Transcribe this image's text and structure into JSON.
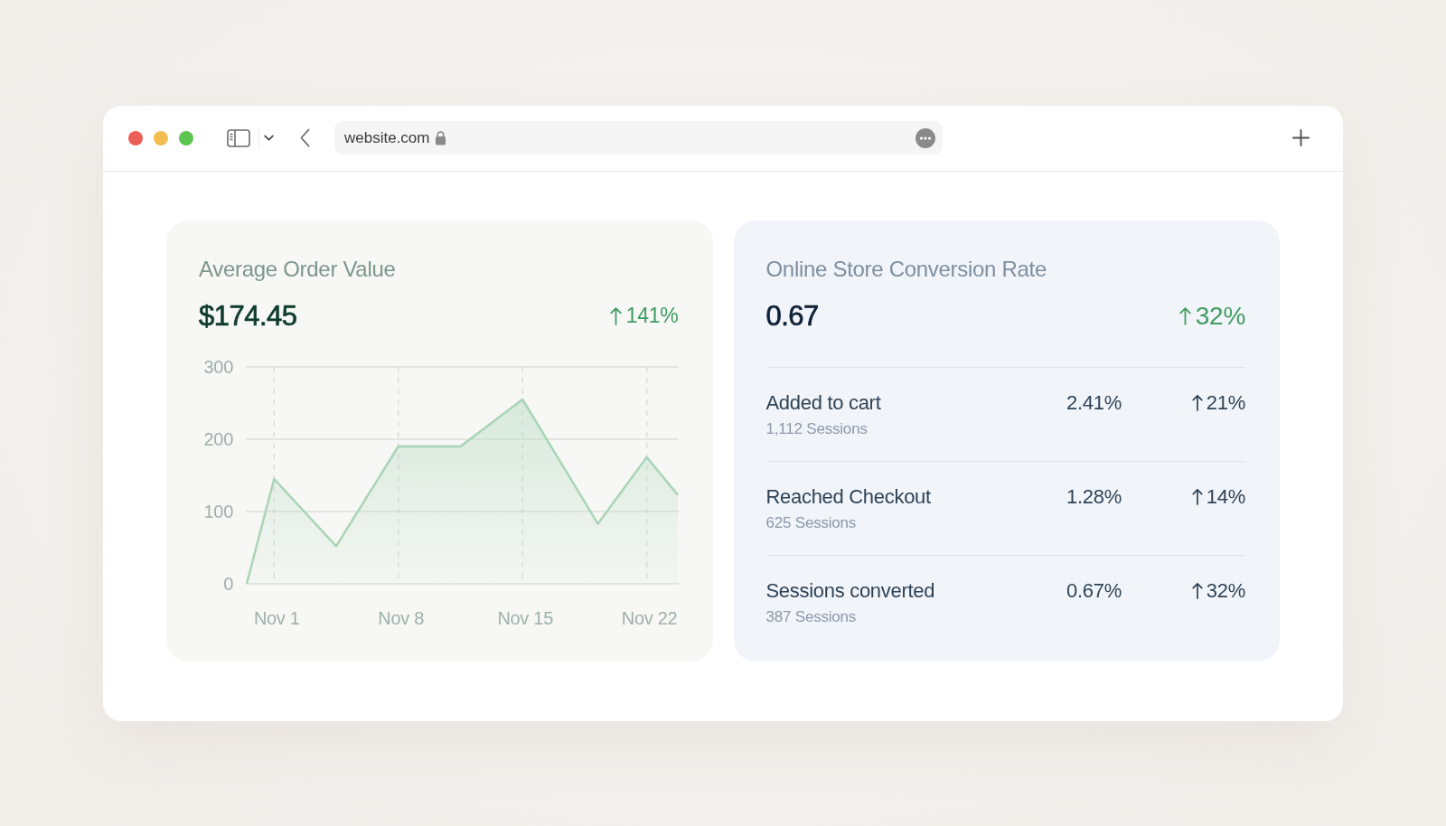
{
  "browser": {
    "url": "website.com"
  },
  "order_value_card": {
    "title": "Average Order Value",
    "value": "$174.45",
    "change": "141%",
    "chart_data": [
      {
        "type": "area",
        "x": [
          "--10-30T11:00",
          "--11-01",
          "--11-04T12:00",
          "--11-08",
          "--11-11T12:00",
          "--11-15",
          "--11-19T06:00",
          "--11-22",
          "--11-23T18:00"
        ],
        "values": [
          0,
          145,
          52,
          190,
          190,
          255,
          83,
          175,
          123
        ],
        "color": "#a9d5b6",
        "xlim": [
          "--10-30T11:00",
          "--11-23T18:00"
        ],
        "ylim": [
          0,
          300
        ],
        "xticks": [
          {
            "value": "--11-01",
            "label": "Nov 1"
          },
          {
            "value": "--11-08",
            "label": "Nov 8"
          },
          {
            "value": "--11-15",
            "label": "Nov 15"
          },
          {
            "value": "--11-22",
            "label": "Nov 22"
          }
        ],
        "yticks": [
          0,
          100,
          200,
          300
        ],
        "grid": true
      }
    ]
  },
  "conversion_card": {
    "title": "Online Store Conversion Rate",
    "value": "0.67",
    "change": "32%",
    "rows": [
      {
        "label": "Added to cart",
        "sessions": "1,112 Sessions",
        "rate": "2.41%",
        "change": "21%"
      },
      {
        "label": "Reached Checkout",
        "sessions": "625 Sessions",
        "rate": "1.28%",
        "change": "14%"
      },
      {
        "label": "Sessions converted",
        "sessions": "387 Sessions",
        "rate": "0.67%",
        "change": "32%"
      }
    ]
  }
}
